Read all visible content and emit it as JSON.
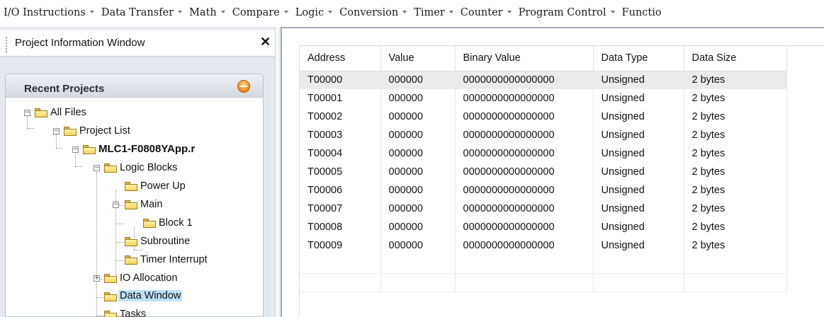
{
  "menu": [
    {
      "label": "I/O Instructions"
    },
    {
      "label": "Data Transfer"
    },
    {
      "label": "Math"
    },
    {
      "label": "Compare"
    },
    {
      "label": "Logic"
    },
    {
      "label": "Conversion"
    },
    {
      "label": "Timer"
    },
    {
      "label": "Counter"
    },
    {
      "label": "Program Control"
    },
    {
      "label": "Functio"
    }
  ],
  "pane": {
    "title": "Project Information Window",
    "close_glyph": "✕"
  },
  "recent": {
    "title": "Recent Projects"
  },
  "tree": {
    "all_files": "All Files",
    "project_list": "Project List",
    "project": "MLC1-F0808YApp.r",
    "logic_blocks": "Logic Blocks",
    "power_up": "Power Up",
    "main": "Main",
    "block1": "Block 1",
    "subroutine": "Subroutine",
    "timer_interrupt": "Timer Interrupt",
    "io_allocation": "IO Allocation",
    "data_window": "Data Window",
    "tasks": "Tasks"
  },
  "grid": {
    "columns": [
      "Address",
      "Value",
      "Binary Value",
      "Data Type",
      "Data Size"
    ],
    "rows": [
      [
        "T00000",
        "000000",
        "0000000000000000",
        "Unsigned",
        "2 bytes"
      ],
      [
        "T00001",
        "000000",
        "0000000000000000",
        "Unsigned",
        "2 bytes"
      ],
      [
        "T00002",
        "000000",
        "0000000000000000",
        "Unsigned",
        "2 bytes"
      ],
      [
        "T00003",
        "000000",
        "0000000000000000",
        "Unsigned",
        "2 bytes"
      ],
      [
        "T00004",
        "000000",
        "0000000000000000",
        "Unsigned",
        "2 bytes"
      ],
      [
        "T00005",
        "000000",
        "0000000000000000",
        "Unsigned",
        "2 bytes"
      ],
      [
        "T00006",
        "000000",
        "0000000000000000",
        "Unsigned",
        "2 bytes"
      ],
      [
        "T00007",
        "000000",
        "0000000000000000",
        "Unsigned",
        "2 bytes"
      ],
      [
        "T00008",
        "000000",
        "0000000000000000",
        "Unsigned",
        "2 bytes"
      ],
      [
        "T00009",
        "000000",
        "0000000000000000",
        "Unsigned",
        "2 bytes"
      ]
    ],
    "selected_row": 0
  },
  "colors": {
    "selection": "#bfe0f5",
    "folder": "#f2d45c",
    "collapse_button": "#f08a1c"
  }
}
